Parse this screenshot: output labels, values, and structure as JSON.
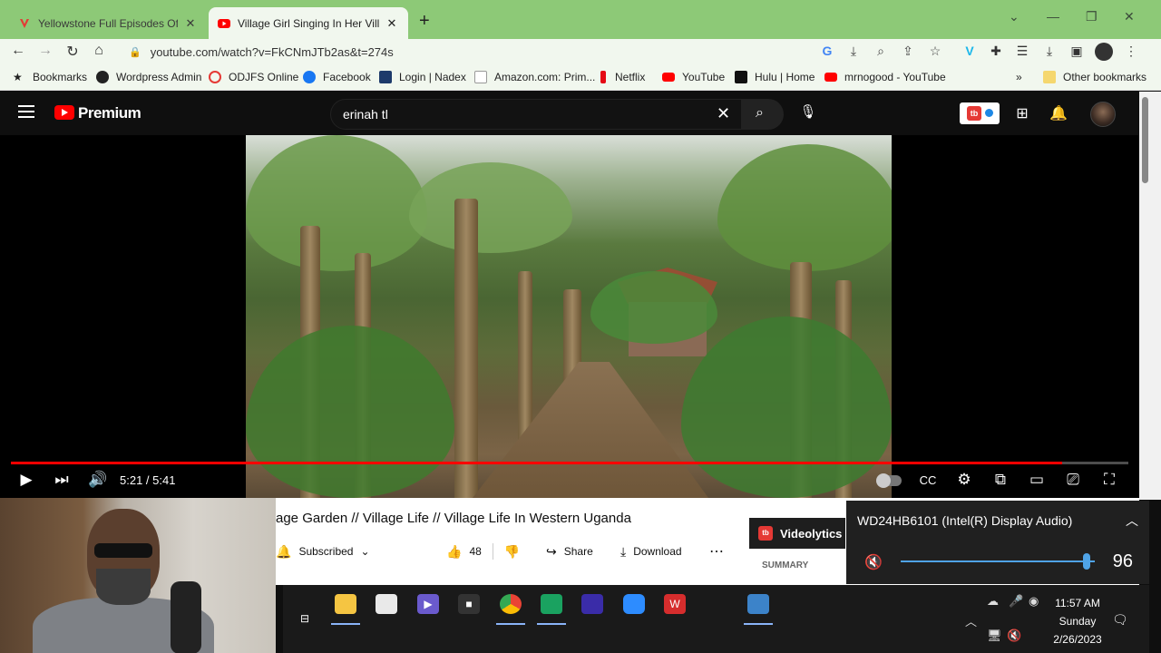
{
  "tabs": [
    {
      "title": "Yellowstone Full Episodes Of Sea",
      "active": false
    },
    {
      "title": "Village Girl Singing In Her Village",
      "active": true
    }
  ],
  "url": "youtube.com/watch?v=FkCNmJTb2as&t=274s",
  "bookmarks": [
    {
      "label": "Bookmarks",
      "icon": "star-icon"
    },
    {
      "label": "Wordpress Admin",
      "icon": "wordpress-icon"
    },
    {
      "label": "ODJFS Online",
      "icon": "odjfs-icon"
    },
    {
      "label": "Facebook",
      "icon": "facebook-icon"
    },
    {
      "label": "Login | Nadex",
      "icon": "nadex-icon"
    },
    {
      "label": "Amazon.com: Prim...",
      "icon": "amazon-icon"
    },
    {
      "label": "Netflix",
      "icon": "netflix-icon"
    },
    {
      "label": "YouTube",
      "icon": "youtube-icon"
    },
    {
      "label": "Hulu | Home",
      "icon": "hulu-icon"
    },
    {
      "label": "mrnogood - YouTube",
      "icon": "youtube-icon"
    },
    {
      "label": "Other bookmarks",
      "icon": "folder-icon"
    }
  ],
  "youtube": {
    "brand": "Premium",
    "search_query": "erinah tl"
  },
  "player": {
    "current_time": "5:21 / 5:41",
    "progress_fraction": 0.941
  },
  "video": {
    "title": "age Garden // Village Life // Village Life In Western Uganda",
    "subscribed_label": "Subscribed",
    "like_count": "48",
    "share_label": "Share",
    "download_label": "Download"
  },
  "videolytics": {
    "label": "Videolytics",
    "summary_label": "SUMMARY"
  },
  "volume_flyout": {
    "device": "WD24HB6101 (Intel(R) Display Audio)",
    "volume": "96",
    "volume_fraction": 0.96
  },
  "clock": {
    "time": "11:57 AM",
    "day": "Sunday",
    "date": "2/26/2023"
  },
  "colors": {
    "tabstrip": "#8dc977",
    "youtube_red": "#ff0000",
    "flyout_bg": "#202020",
    "accent_blue": "#4fa3e6"
  }
}
